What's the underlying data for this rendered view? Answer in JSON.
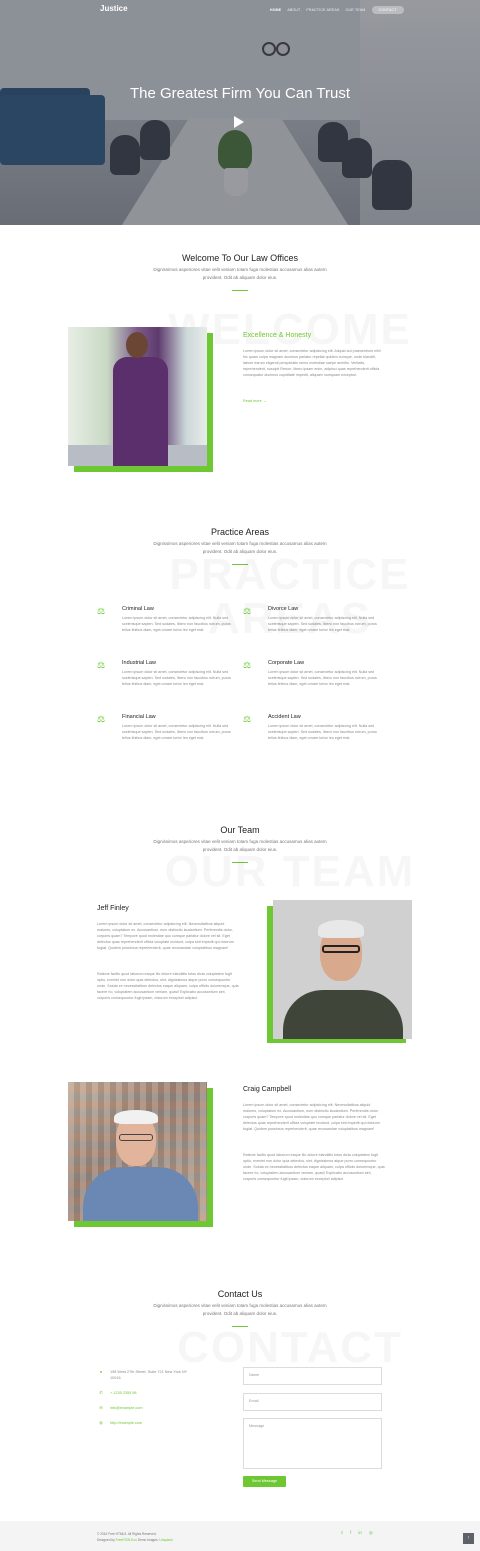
{
  "header": {
    "logo": "Justice",
    "nav": [
      "HOME",
      "ABOUT",
      "PRACTICE AREAS",
      "OUR TEAM"
    ],
    "contact_button": "CONTACT"
  },
  "hero": {
    "title": "The Greatest Firm You Can Trust"
  },
  "welcome": {
    "title": "Welcome To Our Law Offices",
    "subtitle": "Dignissimos asperiores vitae velit veniam totam fuga molestias accusamus alias autem provident. Odit ab aliquam dolor eius.",
    "ghost": "WELCOME",
    "heading": "Excellence & Honesty",
    "body": "Lorem ipsum dolor sit amet, consectetur adipisicing elit. Aliquid aut praesentium nihil hic quam culpa magnam ducimus pariatur repellat quidem cumque, unde blanditi, labore earum eligendi perspiciatis nemo molestiae saepe architio. Veritatis, reprehenderit, suscipit Rerum, libero ipsam enim, adipisci quas reprehenderit officia consequatur ducimus cupiditate impedit, aliquam numquam excepturi.",
    "link": "Read more →"
  },
  "practice": {
    "title": "Practice Areas",
    "subtitle": "Dignissimos asperiores vitae velit veniam totam fuga molestias accusamus alias autem provident. Odit ab aliquam dolor eius.",
    "ghost": "PRACTICE AREAS",
    "items": [
      {
        "title": "Criminal Law",
        "text": "Lorem ipsum dolor sit amet, consectetur adipiscing elit. Nulla sed scelerisque sapien. Sed sodales, libero non faucibus rutrum, purus tellus finibus diam, eget ornare tortor leo eget erat."
      },
      {
        "title": "Divorce Law",
        "text": "Lorem ipsum dolor sit amet, consectetur adipiscing elit. Nulla sed scelerisque sapien. Sed sodales, libero non faucibus rutrum, purus tellus finibus diam, eget ornare tortor leo eget erat."
      },
      {
        "title": "Industrial Law",
        "text": "Lorem ipsum dolor sit amet, consectetur adipiscing elit. Nulla sed scelerisque sapien. Sed sodales, libero non faucibus rutrum, purus tellus finibus diam, eget ornare tortor leo eget erat."
      },
      {
        "title": "Corporate Law",
        "text": "Lorem ipsum dolor sit amet, consectetur adipiscing elit. Nulla sed scelerisque sapien. Sed sodales, libero non faucibus rutrum, purus tellus finibus diam, eget ornare tortor leo eget erat."
      },
      {
        "title": "Financial Law",
        "text": "Lorem ipsum dolor sit amet, consectetur adipiscing elit. Nulla sed scelerisque sapien. Sed sodales, libero non faucibus rutrum, purus tellus finibus diam, eget ornare tortor leo eget erat."
      },
      {
        "title": "Accident Law",
        "text": "Lorem ipsum dolor sit amet, consectetur adipiscing elit. Nulla sed scelerisque sapien. Sed sodales, libero non faucibus rutrum, purus tellus finibus diam, eget ornare tortor leo eget erat."
      }
    ]
  },
  "team": {
    "title": "Our Team",
    "subtitle": "Dignissimos asperiores vitae velit veniam totam fuga molestias accusamus alias autem provident. Odit ab aliquam dolor eius.",
    "ghost": "OUR TEAM",
    "members": [
      {
        "name": "Jeff Finley",
        "p1": "Lorem ipsum dolor sit amet, consectetur adipisicing elit. Necessitatibus aliquid maiores, voluptatum ex. Accusantium, eum distinctio laudantium. Perferendis dolor, corporis quam? Tempore quod molestiae quo cumque pariatur dolore vel sit. Eget delectus quas reprehenderit officia voluptate incidunt, culpa sint impedit qui dolorum fugiat. Quidem possimus reprehenderit, quae recusandae voluptatibus magnam!",
        "p2": "Ratione facilis quod laborum eaque illo dolore blanditiis totos dicta voluptatem fugit optio, eveniet non dolor quia delectus, sint, dignissimos atque porro consequuntur unde. Soluta ex necessitatibus delectus eaque aliquam, culpa officiis doloremque, quia facere rio, voluptatem accusantium veniam, quasi! Explicabo accusantium sint, corporis consequuntur fugit ipsam, dolorum excepturi adipisci."
      },
      {
        "name": "Craig Campbell",
        "p1": "Lorem ipsum dolor sit amet, consectetur adipisicing elit. Necessitatibus aliquid maiores, voluptatum ex. Accusantium, eum distinctio laudantium. Perferendis dolor, corporis quam? Tempore quod molestiae quo cumque pariatur dolore vel sit. Eget delectus quas reprehenderit officia voluptate incidunt, culpa sint impedit qui dolorum fugiat. Quidem possimus reprehenderit, quae recusandae voluptatibus magnam!",
        "p2": "Ratione facilis quod laborum eaque illo dolore blanditiis totos dicta voluptatem fugit optio, eveniet non dolor quia delectus, sint, dignissimos atque porro consequuntur unde. Soluta ex necessitatibus delectus eaque aliquam, culpa officiis doloremque, quia facere rio, voluptatem accusantium veniam, quasi! Explicabo accusantium sint, corporis consequuntur fugit ipsam, dolorum excepturi adipisci."
      }
    ]
  },
  "contact": {
    "title": "Contact Us",
    "subtitle": "Dignissimos asperiores vitae velit veniam totam fuga molestias accusamus alias autem provident. Odit ab aliquam dolor eius.",
    "ghost": "CONTACT",
    "address": "198 West 27th Street, Suite 721 New York NY 10016",
    "phone": "+ 1235 2355 98",
    "email": "info@example.com",
    "website": "http://example.com",
    "form": {
      "name_placeholder": "Name",
      "email_placeholder": "Email",
      "message_placeholder": "Message",
      "send_label": "Send Message"
    }
  },
  "footer": {
    "copyright": "© 2016 Free HTML5. All Rights Reserved.",
    "designed_prefix": "Designed by",
    "designed_by": "FreeHTML5.co",
    "demo_prefix": "Demo Images:",
    "demo_images": "Unsplash",
    "socials": [
      "twitter-icon",
      "facebook-icon",
      "linkedin-icon",
      "dribbble-icon"
    ]
  },
  "colors": {
    "accent": "#6ec834",
    "hero_overlay": "#2d323c"
  }
}
